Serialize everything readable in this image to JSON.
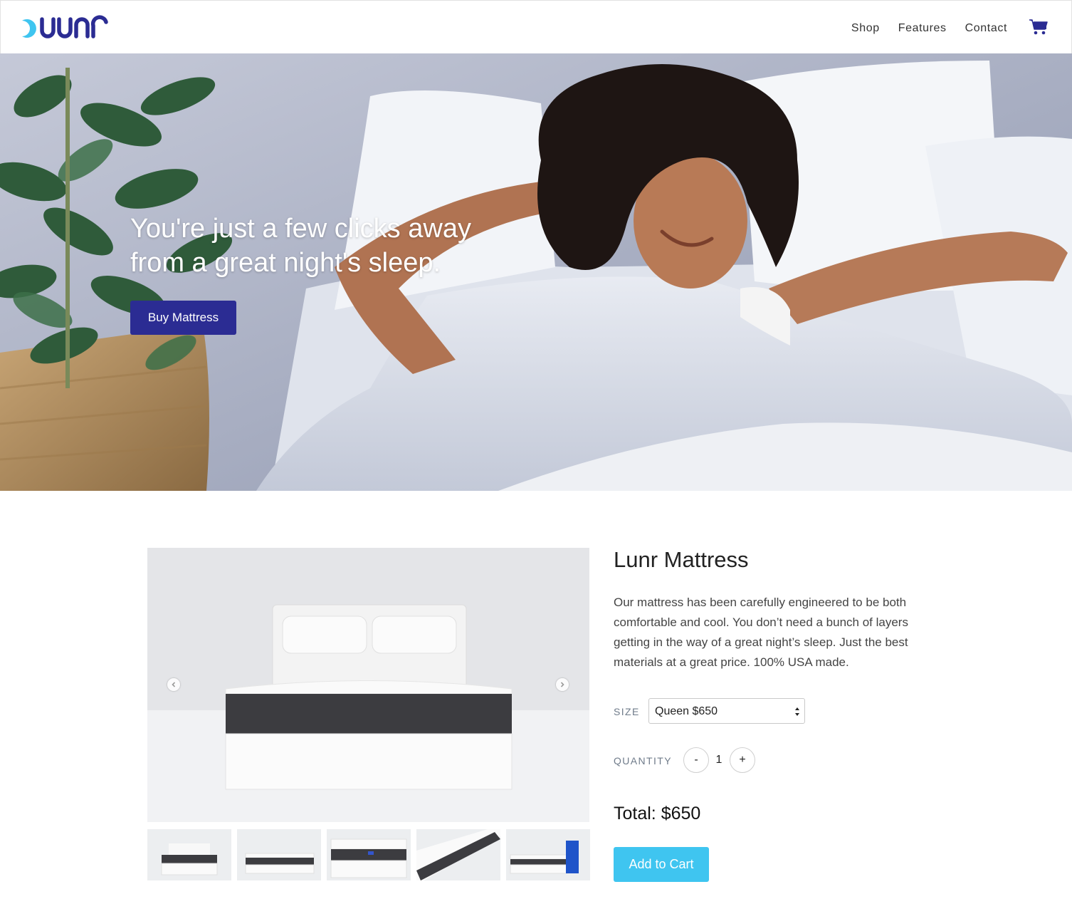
{
  "brand": {
    "name": "lunr",
    "accent": "#2b2c93",
    "moon_color": "#3fc5f0"
  },
  "nav": {
    "items": [
      {
        "label": "Shop"
      },
      {
        "label": "Features"
      },
      {
        "label": "Contact"
      }
    ],
    "cart_icon": "shopping-cart-icon"
  },
  "hero": {
    "headline_line1": "You're just a few clicks away",
    "headline_line2": "from a great night's sleep.",
    "button_label": "Buy Mattress"
  },
  "product": {
    "title": "Lunr Mattress",
    "description": "Our mattress has been carefully engineered to be both comfortable and cool. You don’t need a bunch of layers getting in the way of a great night’s sleep. Just the best materials at a great price. 100% USA made.",
    "size_label": "SIZE",
    "size_selected": "Queen $650",
    "quantity_label": "QUANTITY",
    "quantity_minus": "-",
    "quantity_value": "1",
    "quantity_plus": "+",
    "total": "Total: $650",
    "add_to_cart_label": "Add to Cart",
    "add_to_cart_color": "#3fc5f0",
    "gallery_icons": {
      "prev": "chevron-left-icon",
      "next": "chevron-right-icon"
    },
    "thumbnail_count": 5
  }
}
